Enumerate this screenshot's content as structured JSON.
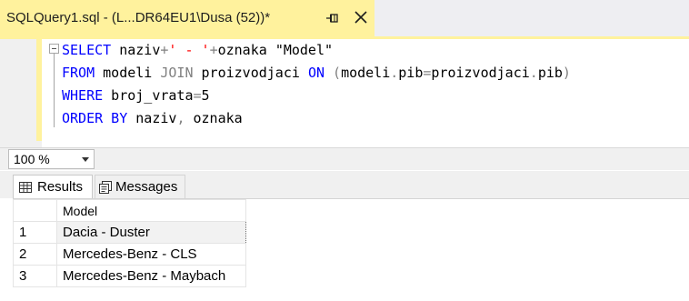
{
  "tab": {
    "title": "SQLQuery1.sql - (L...DR64EU1\\Dusa (52))*"
  },
  "editor": {
    "lines": [
      [
        {
          "t": "SELECT",
          "c": "kw"
        },
        {
          "t": " naziv",
          "c": ""
        },
        {
          "t": "+",
          "c": "gr"
        },
        {
          "t": "' - '",
          "c": "st"
        },
        {
          "t": "+",
          "c": "gr"
        },
        {
          "t": "oznaka ",
          "c": ""
        },
        {
          "t": "\"Model\"",
          "c": ""
        }
      ],
      [
        {
          "t": "FROM",
          "c": "kw"
        },
        {
          "t": " modeli ",
          "c": ""
        },
        {
          "t": "JOIN",
          "c": "gr"
        },
        {
          "t": " proizvodjaci ",
          "c": ""
        },
        {
          "t": "ON",
          "c": "kw"
        },
        {
          "t": " ",
          "c": ""
        },
        {
          "t": "(",
          "c": "gr"
        },
        {
          "t": "modeli",
          "c": ""
        },
        {
          "t": ".",
          "c": "gr"
        },
        {
          "t": "pib",
          "c": ""
        },
        {
          "t": "=",
          "c": "gr"
        },
        {
          "t": "proizvodjaci",
          "c": ""
        },
        {
          "t": ".",
          "c": "gr"
        },
        {
          "t": "pib",
          "c": ""
        },
        {
          "t": ")",
          "c": "gr"
        }
      ],
      [
        {
          "t": "WHERE",
          "c": "kw"
        },
        {
          "t": " broj_vrata",
          "c": ""
        },
        {
          "t": "=",
          "c": "gr"
        },
        {
          "t": "5",
          "c": ""
        }
      ],
      [
        {
          "t": "ORDER BY",
          "c": "kw"
        },
        {
          "t": " naziv",
          "c": ""
        },
        {
          "t": ",",
          "c": "gr"
        },
        {
          "t": " oznaka",
          "c": ""
        }
      ]
    ]
  },
  "zoom": {
    "value": "100 %"
  },
  "results_tabs": {
    "results_label": "Results",
    "messages_label": "Messages"
  },
  "grid": {
    "header": "Model",
    "rows": [
      {
        "num": "1",
        "value": "Dacia - Duster"
      },
      {
        "num": "2",
        "value": "Mercedes-Benz - CLS"
      },
      {
        "num": "3",
        "value": "Mercedes-Benz - Maybach"
      }
    ]
  },
  "colors": {
    "tab_bg": "#fff29d",
    "keyword": "#0000ff",
    "operator": "#808080",
    "string": "#ff0000"
  }
}
